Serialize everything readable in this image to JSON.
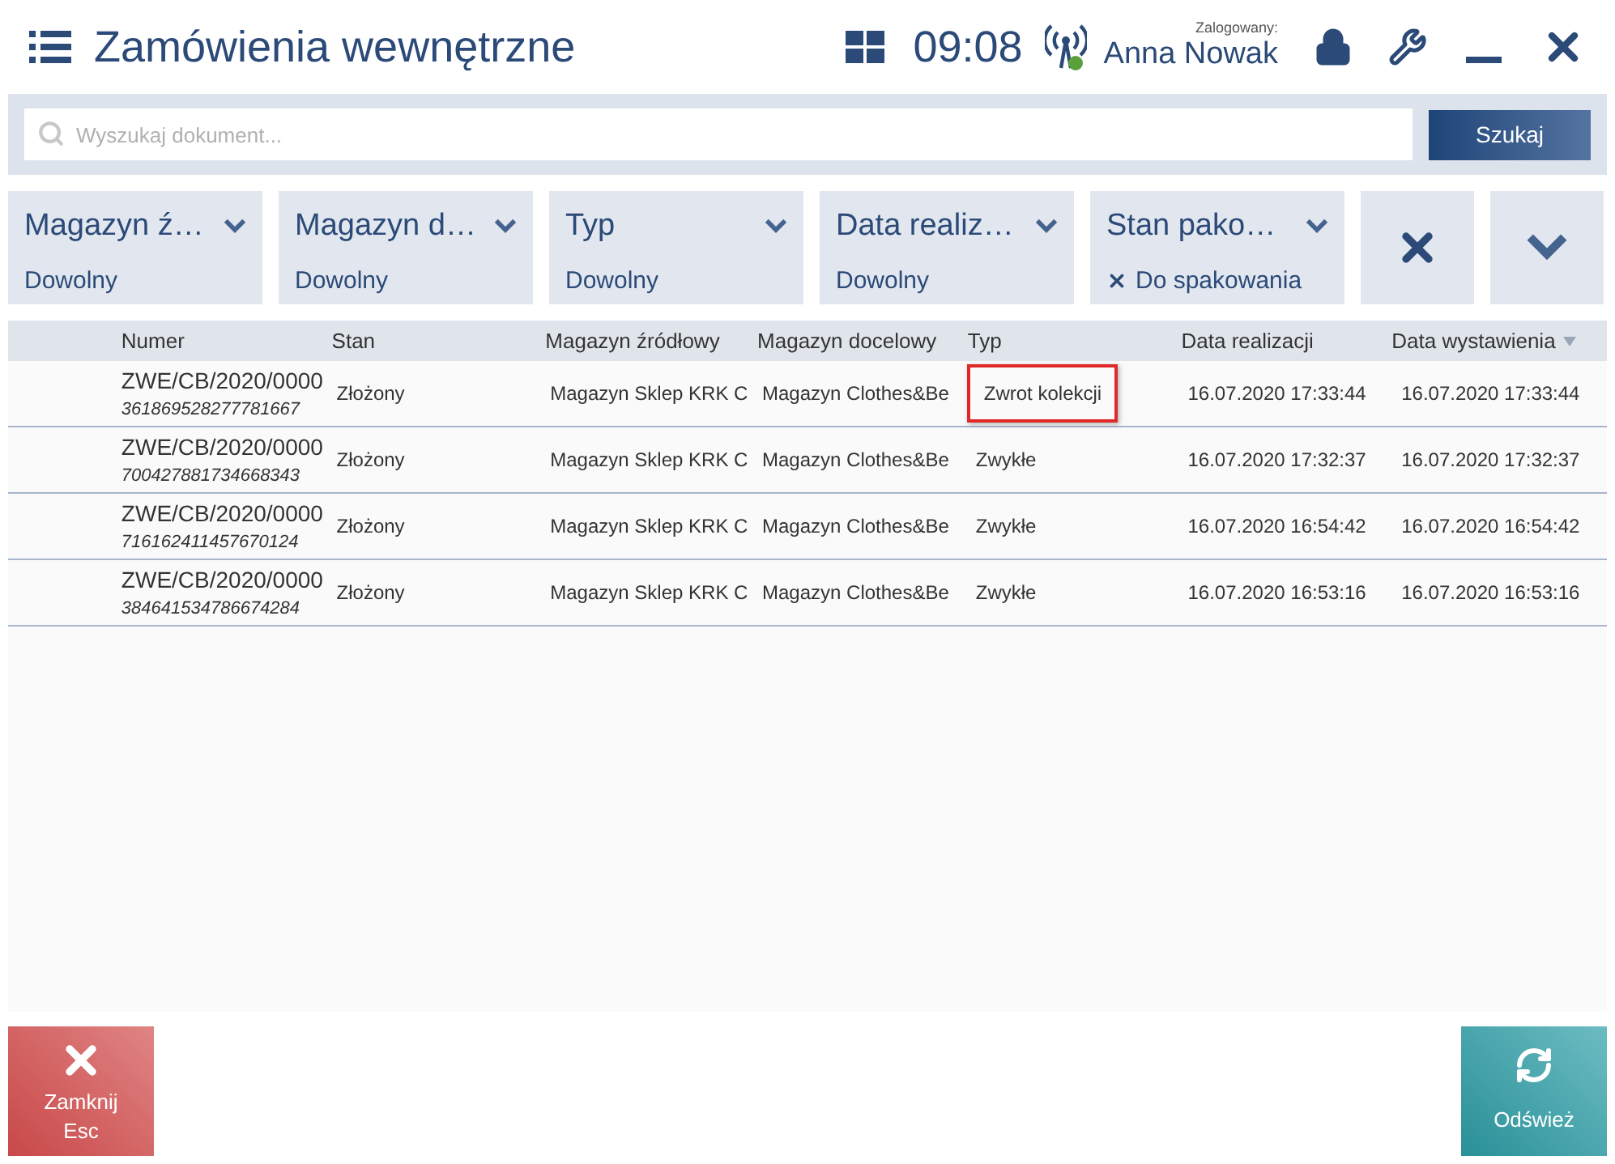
{
  "header": {
    "title": "Zamówienia wewnętrzne",
    "time": "09:08",
    "logged_label": "Zalogowany:",
    "user": "Anna Nowak",
    "online": true
  },
  "search": {
    "placeholder": "Wyszukaj dokument...",
    "button": "Szukaj"
  },
  "filters": [
    {
      "label": "Magazyn ź…",
      "value": "Dowolny",
      "clearable": false
    },
    {
      "label": "Magazyn d…",
      "value": "Dowolny",
      "clearable": false
    },
    {
      "label": "Typ",
      "value": "Dowolny",
      "clearable": false
    },
    {
      "label": "Data realiz…",
      "value": "Dowolny",
      "clearable": false
    },
    {
      "label": "Stan pako…",
      "value": "Do spakowania",
      "clearable": true
    }
  ],
  "table": {
    "columns": [
      {
        "label": "Numer",
        "sorted_desc": false
      },
      {
        "label": "Stan",
        "sorted_desc": false
      },
      {
        "label": "Magazyn źródłowy",
        "sorted_desc": false
      },
      {
        "label": "Magazyn docelowy",
        "sorted_desc": false
      },
      {
        "label": "Typ",
        "sorted_desc": false
      },
      {
        "label": "Data realizacji",
        "sorted_desc": false
      },
      {
        "label": "Data wystawienia",
        "sorted_desc": true
      }
    ],
    "rows": [
      {
        "number": "ZWE/CB/2020/0000",
        "code": "361869528277781667",
        "status": "Złożony",
        "source": "Magazyn Sklep KRK C",
        "target": "Magazyn Clothes&Be",
        "type": "Zwrot kolekcji",
        "type_highlighted": true,
        "realization": "16.07.2020 17:33:44",
        "issued": "16.07.2020 17:33:44"
      },
      {
        "number": "ZWE/CB/2020/0000",
        "code": "700427881734668343",
        "status": "Złożony",
        "source": "Magazyn Sklep KRK C",
        "target": "Magazyn Clothes&Be",
        "type": "Zwykłe",
        "type_highlighted": false,
        "realization": "16.07.2020 17:32:37",
        "issued": "16.07.2020 17:32:37"
      },
      {
        "number": "ZWE/CB/2020/0000",
        "code": "716162411457670124",
        "status": "Złożony",
        "source": "Magazyn Sklep KRK C",
        "target": "Magazyn Clothes&Be",
        "type": "Zwykłe",
        "type_highlighted": false,
        "realization": "16.07.2020 16:54:42",
        "issued": "16.07.2020 16:54:42"
      },
      {
        "number": "ZWE/CB/2020/0000",
        "code": "384641534786674284",
        "status": "Złożony",
        "source": "Magazyn Sklep KRK C",
        "target": "Magazyn Clothes&Be",
        "type": "Zwykłe",
        "type_highlighted": false,
        "realization": "16.07.2020 16:53:16",
        "issued": "16.07.2020 16:53:16"
      }
    ]
  },
  "footer": {
    "close_label": "Zamknij",
    "close_key": "Esc",
    "refresh_label": "Odśwież"
  }
}
